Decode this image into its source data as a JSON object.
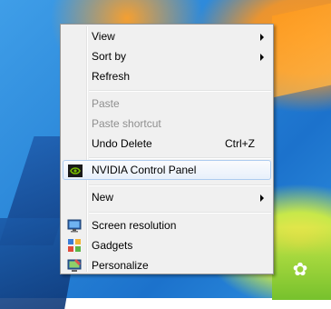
{
  "menu": {
    "items": [
      {
        "label": "View",
        "submenu": true
      },
      {
        "label": "Sort by",
        "submenu": true
      },
      {
        "label": "Refresh"
      },
      {
        "label": "Paste",
        "disabled": true
      },
      {
        "label": "Paste shortcut",
        "disabled": true
      },
      {
        "label": "Undo Delete",
        "shortcut": "Ctrl+Z"
      },
      {
        "label": "NVIDIA Control Panel",
        "icon": "nvidia-icon",
        "highlighted": true
      },
      {
        "label": "New",
        "submenu": true
      },
      {
        "label": "Screen resolution",
        "icon": "monitor-icon"
      },
      {
        "label": "Gadgets",
        "icon": "gadgets-icon"
      },
      {
        "label": "Personalize",
        "icon": "personalize-icon"
      }
    ]
  },
  "colors": {
    "menu_bg": "#f0f0f0",
    "highlight_border": "#aeccf0",
    "disabled_text": "#8f8f8f",
    "nvidia_green": "#76b900"
  }
}
